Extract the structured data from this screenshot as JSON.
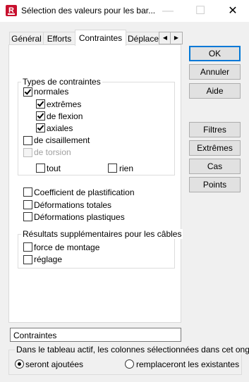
{
  "window": {
    "title": "Sélection des valeurs pour les bar...",
    "app_icon_letter": "R",
    "minimize_glyph": "—",
    "maximize_glyph": "☐",
    "close_glyph": "✕"
  },
  "tabs": [
    {
      "label": "Général",
      "active": false
    },
    {
      "label": "Efforts",
      "active": false
    },
    {
      "label": "Contraintes",
      "active": true
    },
    {
      "label": "Déplacen",
      "active": false
    }
  ],
  "tab_scroll": {
    "left": "◀",
    "right": "▶"
  },
  "constraints": {
    "group_label": "Types de contraintes",
    "normales": {
      "label": "normales",
      "checked": true
    },
    "extremes": {
      "label": "extrêmes",
      "checked": true
    },
    "flexion": {
      "label": "de flexion",
      "checked": true
    },
    "axiales": {
      "label": "axiales",
      "checked": true
    },
    "cisaillement": {
      "label": "de cisaillement",
      "checked": false
    },
    "torsion": {
      "label": "de torsion",
      "checked": false,
      "disabled": true
    },
    "tout": {
      "label": "tout",
      "checked": false
    },
    "rien": {
      "label": "rien",
      "checked": false
    }
  },
  "options": {
    "plastification": {
      "label": "Coefficient de plastification",
      "checked": false
    },
    "totales": {
      "label": "Déformations totales",
      "checked": false
    },
    "plastiques": {
      "label": "Déformations plastiques",
      "checked": false
    }
  },
  "cables": {
    "group_label": "Résultats supplémentaires pour les câbles",
    "montage": {
      "label": "force de montage",
      "checked": false
    },
    "reglage": {
      "label": "réglage",
      "checked": false
    }
  },
  "buttons": {
    "ok": "OK",
    "annuler": "Annuler",
    "aide": "Aide",
    "filtres": "Filtres",
    "extremes": "Extrêmes",
    "cas": "Cas",
    "points": "Points"
  },
  "name_field": {
    "value": "Contraintes"
  },
  "table_columns": {
    "group_label": "Dans le tableau actif, les colonnes sélectionnées dans cet onglet",
    "added": {
      "label": "seront ajoutées",
      "selected": true
    },
    "replace": {
      "label": "remplaceront les existantes",
      "selected": false
    }
  },
  "colors": {
    "accent": "#0078d7",
    "app_icon": "#c8102e"
  }
}
